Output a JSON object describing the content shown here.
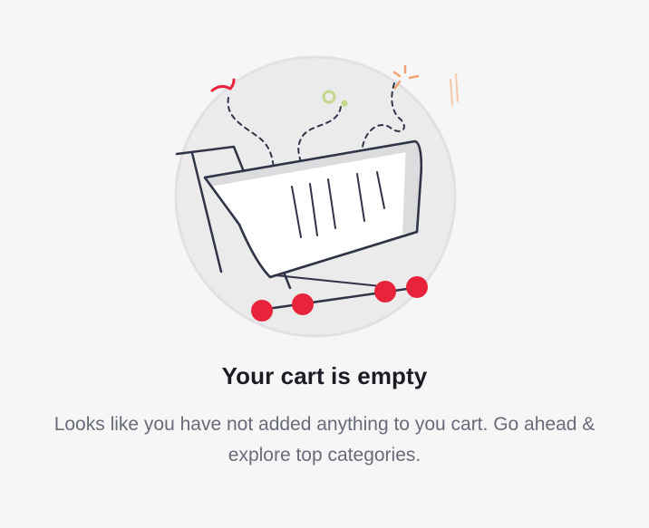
{
  "empty_state": {
    "title": "Your cart is empty",
    "message": "Looks like you have not added anything to you cart. Go ahead & explore top categories."
  },
  "illustration": {
    "icon": "empty-shopping-cart-icon",
    "colors": {
      "outline": "#2f3447",
      "wheels": "#e8243c",
      "circle_fill": "#ebebec",
      "circle_stroke": "#e1e1e3",
      "cart_fill": "#ffffff",
      "cart_shade": "#dcdcdf",
      "accent_red": "#e8243c",
      "accent_orange": "#f2a374",
      "accent_green": "#c3d88a"
    }
  }
}
